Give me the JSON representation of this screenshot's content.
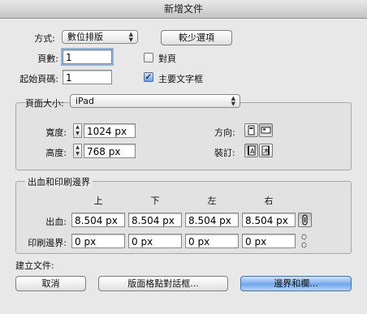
{
  "window": {
    "title": "新增文件"
  },
  "document": {
    "intent_label": "方式:",
    "intent_value": "數位排版",
    "fewer_options_label": "較少選項",
    "pages_label": "頁數:",
    "pages_value": "1",
    "facing_pages_label": "對頁",
    "facing_pages_checked": false,
    "start_page_label": "起始頁碼:",
    "start_page_value": "1",
    "primary_text_frame_label": "主要文字框",
    "primary_text_frame_checked": true
  },
  "page_size": {
    "label": "頁面大小:",
    "value": "iPad",
    "width_label": "寬度:",
    "width_value": "1024 px",
    "height_label": "高度:",
    "height_value": "768 px",
    "orientation_label": "方向:",
    "binding_label": "裝訂:"
  },
  "bleed_slug": {
    "label": "出血和印刷邊界",
    "columns": [
      "上",
      "下",
      "左",
      "右"
    ],
    "bleed_label": "出血:",
    "bleed_values": [
      "8.504 px",
      "8.504 px",
      "8.504 px",
      "8.504 px"
    ],
    "slug_label": "印刷邊界:",
    "slug_values": [
      "0 px",
      "0 px",
      "0 px",
      "0 px"
    ]
  },
  "footer": {
    "create_label": "建立文件:",
    "cancel_label": "取消",
    "layout_grid_label": "版面格點對話框...",
    "margins_columns_label": "邊界和欄..."
  }
}
